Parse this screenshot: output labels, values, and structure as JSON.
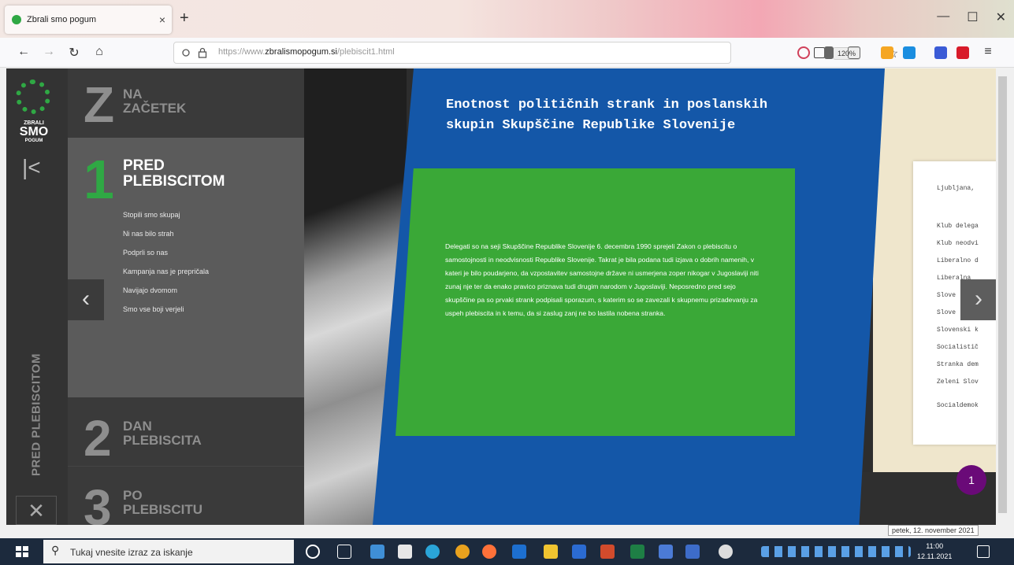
{
  "browser": {
    "tab_title": "Zbrali smo pogum",
    "tab_close": "×",
    "new_tab": "+",
    "url_prefix": "https://www.",
    "url_domain": "zbralismopogum.si",
    "url_path": "/plebiscit1.html",
    "zoom": "120%"
  },
  "logo": {
    "line1": "ZBRALI",
    "line2": "SMO",
    "line3": "POGUM"
  },
  "sidebar": {
    "collapse_glyph": "|<",
    "vertical_label": "PRED PLEBISCITOM",
    "close_glyph": "✕"
  },
  "menu": {
    "sections": [
      {
        "num": "Z",
        "line1": "NA",
        "line2": "ZAČETEK"
      },
      {
        "num": "1",
        "line1": "PRED",
        "line2": "PLEBISCITOM"
      },
      {
        "num": "2",
        "line1": "DAN",
        "line2": "PLEBISCITA"
      },
      {
        "num": "3",
        "line1": "PO",
        "line2": "PLEBISCITU"
      }
    ],
    "sub_items": [
      "Stopili smo skupaj",
      "Ni nas bilo strah",
      "Podprli so nas",
      "Kampanja nas je prepričala",
      "Navijajo dvomom",
      "Smo vse boji verjeli"
    ]
  },
  "content": {
    "headline": "Enotnost političnih strank in poslanskih skupin Skupščine Republike Slovenije",
    "body": "Delegati so na seji Skupščine Republike Slovenije 6. decembra 1990 sprejeli Zakon o plebiscitu o samostojnosti in neodvisnosti Republike Slovenije. Takrat je bila podana tudi izjava o dobrih namenih, v kateri je bilo poudarjeno, da vzpostavitev samostojne države ni usmerjena zoper nikogar v Jugoslaviji niti zunaj nje ter da enako pravico priznava tudi drugim narodom v Jugoslaviji. Neposredno pred sejo skupščine pa so prvaki strank podpisali sporazum, s katerim so se zavezali k skupnemu prizadevanju za uspeh plebiscita in k temu, da si zaslug zanj ne bo lastila nobena stranka.",
    "arrow_prev": "‹",
    "arrow_next": "›",
    "page_badge": "1"
  },
  "document": {
    "lines": [
      "Ljubljana,",
      "Klub delega",
      "Klub neodvi",
      "Liberalno d",
      "Liberalna",
      "Slove",
      "Slove",
      "Slovenski k",
      "Socialistič",
      "Stranka dem",
      "Zeleni Slov",
      "Socialdemok"
    ]
  },
  "tooltip": {
    "date": "petek, 12. november 2021"
  },
  "taskbar": {
    "search_placeholder": "Tukaj vnesite izraz za iskanje",
    "time": "11:00",
    "date": "12.11.2021"
  }
}
